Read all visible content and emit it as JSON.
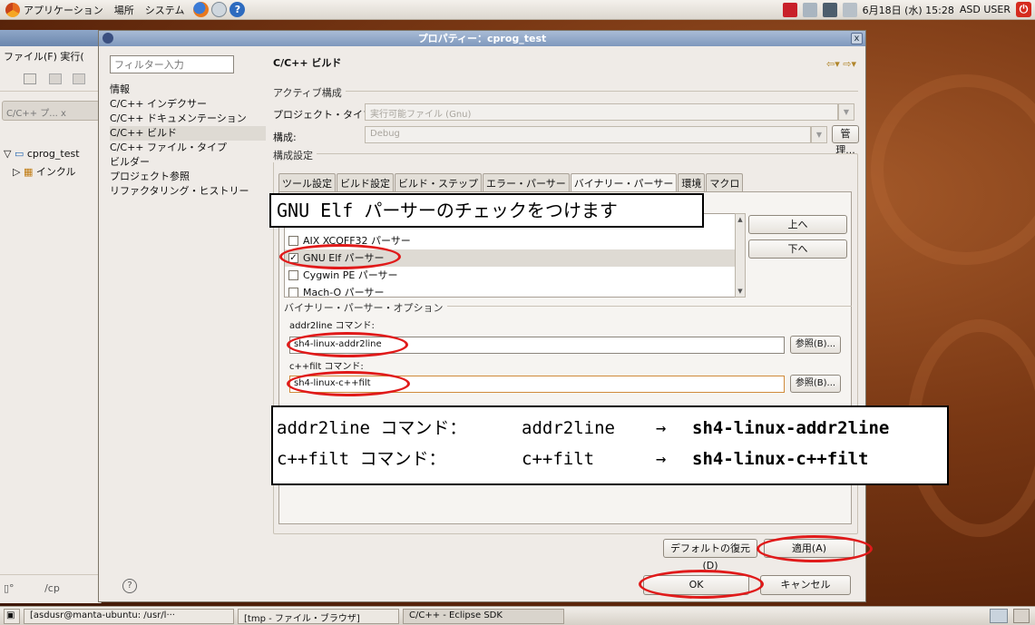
{
  "top_panel": {
    "menus": [
      "アプリケーション",
      "場所",
      "システム"
    ],
    "clock": "6月18日 (水) 15:28",
    "user": "ASD USER"
  },
  "eclipse": {
    "menubar": "ファイル(F)  実行(",
    "view_tab": "C/C++ プ... ⅹ",
    "tree": [
      "cprog_test",
      "インクル"
    ],
    "bottom_text": "/cp"
  },
  "dialog": {
    "title": "プロパティー：cprog_test",
    "close": "x",
    "filter_placeholder": "フィルター入力",
    "nav_items": [
      "情報",
      "C/C++ インデクサー",
      "C/C++ ドキュメンテーション",
      "C/C++ ビルド",
      "C/C++ ファイル・タイプ",
      "ビルダー",
      "プロジェクト参照",
      "リファクタリング・ヒストリー"
    ],
    "heading": "C/C++ ビルド",
    "nav_arrows": "⇦▾ ⇨▾",
    "active_config": {
      "group_label": "アクティブ構成",
      "project_type_label": "プロジェクト・タイプ:",
      "project_type_value": "実行可能ファイル (Gnu)",
      "config_label": "構成:",
      "config_value": "Debug",
      "manage_button": "管理..."
    },
    "config_settings": {
      "group_label": "構成設定",
      "tabs": [
        "ツール設定",
        "ビルド設定",
        "ビルド・ステップ",
        "エラー・パーサー",
        "バイナリー・パーサー",
        "環境",
        "マクロ"
      ],
      "active_tab": "バイナリー・パーサー"
    },
    "parsers": [
      {
        "label": "AIX XCOFF32 パーサー",
        "checked": false
      },
      {
        "label": "GNU Elf パーサー",
        "checked": true
      },
      {
        "label": "Cygwin PE パーサー",
        "checked": false
      },
      {
        "label": "Mach-O パーサー",
        "checked": false
      }
    ],
    "up_button": "上へ",
    "down_button": "下へ",
    "options": {
      "group_label": "バイナリー・パーサー・オプション",
      "addr2line_label": "addr2line コマンド:",
      "addr2line_value": "sh4-linux-addr2line",
      "cppfilt_label": "c++filt コマンド:",
      "cppfilt_value": "sh4-linux-c++filt",
      "browse_button": "参照(B)..."
    },
    "restore_defaults_button": "デフォルトの復元(D)",
    "apply_button": "適用(A)",
    "ok_button": "OK",
    "cancel_button": "キャンセル",
    "help_icon": "?"
  },
  "callouts": {
    "callout1": "GNU  Elf パーサーのチェックをつけます",
    "line1": {
      "a": "addr2line コマンド：",
      "b": "addr2line",
      "arrow": "→",
      "c": "sh4-linux-addr2line"
    },
    "line2": {
      "a": "c++filt  コマンド：",
      "b": "c++filt",
      "arrow": "→",
      "c": "sh4-linux-c++filt"
    }
  },
  "taskbar": {
    "tasks": [
      "[asdusr@manta-ubuntu: /usr/l···",
      "[tmp - ファイル・ブラウザ]",
      "C/C++ - Eclipse SDK"
    ]
  },
  "colors": {
    "accent": "#e01a1a",
    "title_bar": "#7f98bd",
    "wallpaper": "#7a3814"
  }
}
